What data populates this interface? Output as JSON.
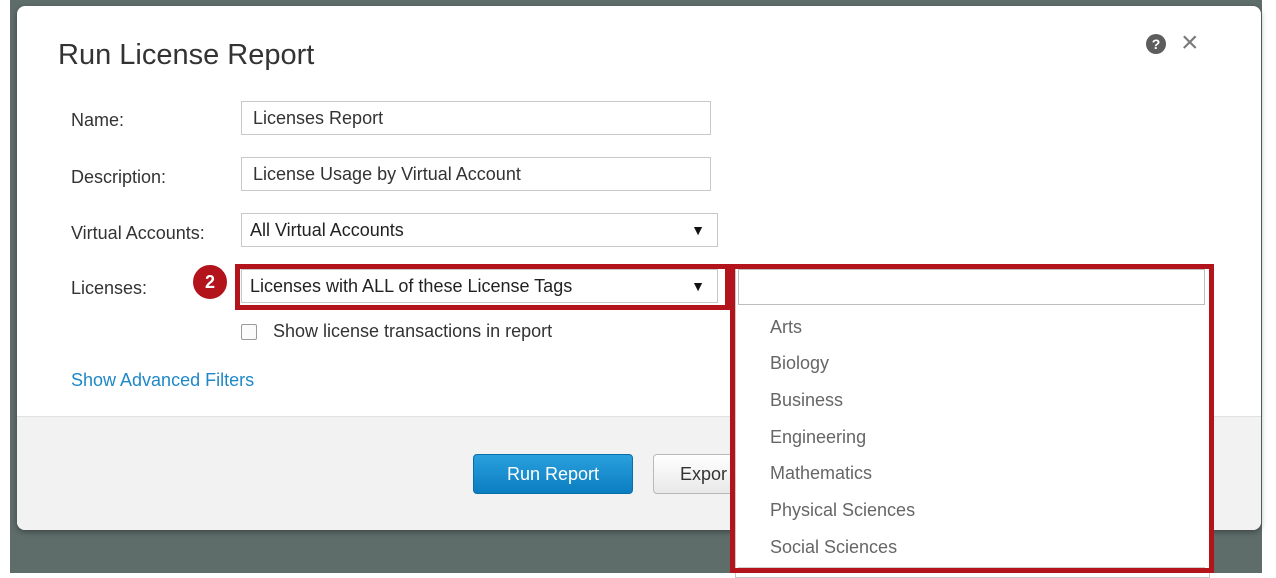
{
  "dialog": {
    "title": "Run License Report",
    "help_icon_glyph": "?",
    "close_icon_glyph": "×"
  },
  "form": {
    "name_label": "Name:",
    "name_value": "Licenses Report",
    "description_label": "Description:",
    "description_value": "License Usage by Virtual Account",
    "virtual_accounts_label": "Virtual Accounts:",
    "virtual_accounts_value": "All Virtual Accounts",
    "licenses_label": "Licenses:",
    "licenses_value": "Licenses with ALL of these License Tags",
    "caret_glyph": "▼",
    "show_transactions_label": "Show license transactions in report",
    "show_transactions_checked": false,
    "advanced_filters_link": "Show Advanced Filters"
  },
  "footer": {
    "run_report_label": "Run Report",
    "export_label": "Expor"
  },
  "callout": {
    "step_number": "2",
    "color": "#b3131b"
  },
  "tag_dropdown": {
    "search_value": "",
    "items": [
      "Arts",
      "Biology",
      "Business",
      "Engineering",
      "Mathematics",
      "Physical Sciences",
      "Social Sciences"
    ]
  },
  "colors": {
    "primary_button": "#1a8ed1",
    "link": "#1e88c7",
    "backdrop": "#5e6c6a"
  }
}
